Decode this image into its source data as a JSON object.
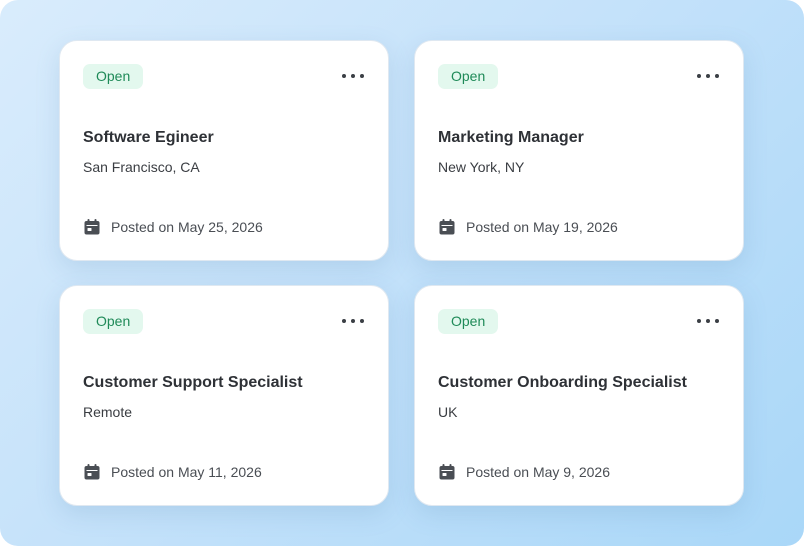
{
  "jobs": [
    {
      "status": "Open",
      "title": "Software Egineer",
      "location": "San Francisco, CA",
      "posted": "Posted on May 25, 2026"
    },
    {
      "status": "Open",
      "title": "Marketing Manager",
      "location": "New York, NY",
      "posted": "Posted on May 19, 2026"
    },
    {
      "status": "Open",
      "title": "Customer Support Specialist",
      "location": "Remote",
      "posted": "Posted on May 11, 2026"
    },
    {
      "status": "Open",
      "title": "Customer Onboarding Specialist",
      "location": "UK",
      "posted": "Posted on May 9, 2026"
    }
  ],
  "icons": {
    "menu": "more-horizontal-icon",
    "date": "calendar-icon"
  },
  "colors": {
    "badge_bg": "#e3f8ee",
    "badge_text": "#1f8a58",
    "background_start": "#d9ecfc",
    "background_end": "#a9d7f8"
  }
}
